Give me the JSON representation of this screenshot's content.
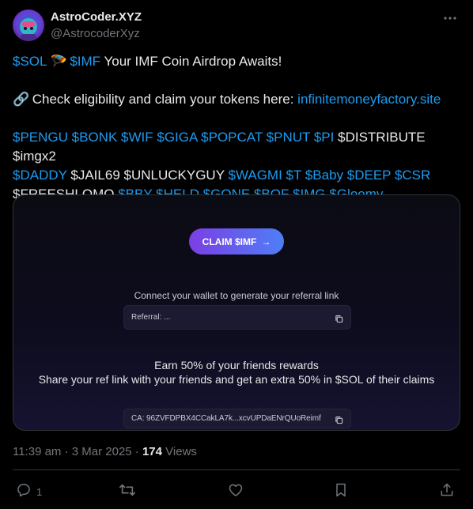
{
  "author": {
    "name": "AstroCoder.XYZ",
    "handle": "@AstrocoderXyz"
  },
  "tweet": {
    "line1": {
      "t1": "$SOL",
      "e1": "🪂",
      "t2": "$IMF",
      "text": " Your IMF Coin Airdrop Awaits!"
    },
    "line2": {
      "emoji": "🔗",
      "text": " Check eligibility and claim your tokens here: ",
      "link": "infinitemoneyfactory.site"
    },
    "tags": {
      "pengu": "$PENGU",
      "bonk": "$BONK",
      "wif": "$WIF",
      "giga": "$GIGA",
      "popcat": "$POPCAT",
      "pnut": "$PNUT",
      "pi": "$PI",
      "distribute": "$DISTRIBUTE",
      "imgx2": "$imgx2",
      "daddy": "$DADDY",
      "jail69": "$JAIL69",
      "unluckyguy": "$UNLUCKYGUY",
      "wagmi": "$WAGMI",
      "t": "$T",
      "baby": "$Baby",
      "deep": "$DEEP",
      "csr": "$CSR",
      "freeshlomo": "$FREESHLOMO",
      "bby": "$BBY",
      "held": "$HELD",
      "gone": "$GONE",
      "bof": "$BOF",
      "img": "$IMG",
      "gloomy": "$Gloomy"
    }
  },
  "card": {
    "claim_label": "CLAIM $IMF",
    "claim_arrow": "→",
    "connect_text": "Connect your wallet to generate your referral link",
    "referral_label": "Referral: ...",
    "earn_line1": "Earn 50% of your friends rewards",
    "earn_line2": "Share your ref link with your friends and get an extra 50% in $SOL of their claims",
    "ca_label": "CA:  96ZVFDPBX4CCakLA7k...xcvUPDaENrQUoReimf"
  },
  "meta": {
    "time": "11:39 am · 3 Mar 2025 · ",
    "views_count": "174",
    "views_label": " Views"
  },
  "actions": {
    "reply_count": "1"
  },
  "colors": {
    "link": "#1d9bf0",
    "text": "#e7e9ea",
    "muted": "#71767b",
    "claim_gradient_start": "#7b3fe4",
    "claim_gradient_end": "#4f7ef7"
  },
  "icons": {
    "more": "more-dots-icon",
    "reply": "reply-bubble-icon",
    "retweet": "retweet-icon",
    "like": "heart-icon",
    "bookmark": "bookmark-icon",
    "share": "share-icon",
    "copy": "copy-icon"
  }
}
